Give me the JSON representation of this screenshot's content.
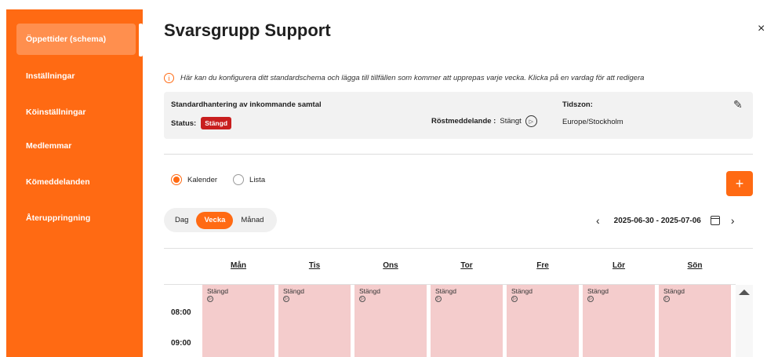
{
  "sidebar": {
    "items": [
      {
        "label": "Öppettider (schema)"
      },
      {
        "label": "Inställningar"
      },
      {
        "label": "Köinställningar"
      },
      {
        "label": "Medlemmar"
      },
      {
        "label": "Kömeddelanden"
      },
      {
        "label": "Återuppringning"
      }
    ]
  },
  "header": {
    "title": "Svarsgrupp Support",
    "close": "×"
  },
  "info": {
    "icon": "i",
    "text": "Här kan du konfigurera ditt standardschema och lägga till tillfällen som kommer att upprepas varje vecka. Klicka på en vardag för att redigera"
  },
  "config": {
    "handling": "Standardhantering av inkommande samtal",
    "status_label": "Status:",
    "status_value": "Stängd",
    "voicemail_label": "Röstmeddelande :",
    "voicemail_value": "Stängt",
    "timezone_label": "Tidszon:",
    "timezone_value": "Europe/Stockholm",
    "edit_icon": "✎"
  },
  "view": {
    "calendar": "Kalender",
    "list": "Lista",
    "selected": "Kalender"
  },
  "add_button": "+",
  "segments": {
    "day": "Dag",
    "week": "Vecka",
    "month": "Månad",
    "active": "Vecka"
  },
  "date_nav": {
    "prev": "‹",
    "range": "2025-06-30 - 2025-07-06",
    "next": "›"
  },
  "calendar": {
    "days": [
      "Mån",
      "Tis",
      "Ons",
      "Tor",
      "Fre",
      "Lör",
      "Sön"
    ],
    "cell_label": "Stängd",
    "play_icon": "▷",
    "times": [
      "08:00",
      "09:00"
    ]
  },
  "colors": {
    "accent": "#ff6a13",
    "closed_badge": "#c81e1e",
    "closed_cell": "#f4cccc"
  }
}
